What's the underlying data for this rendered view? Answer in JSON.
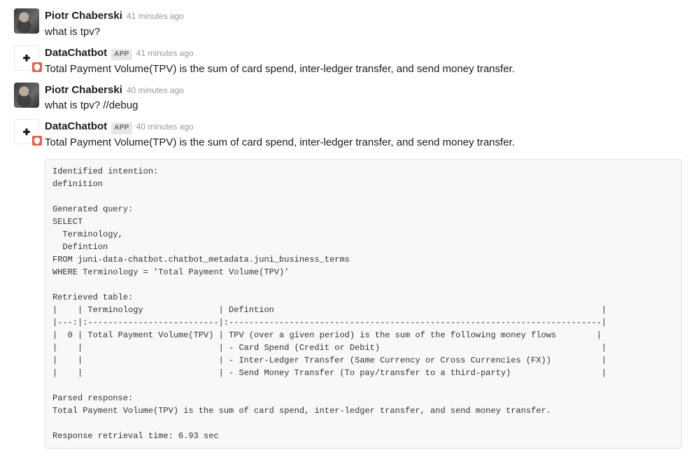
{
  "messages": [
    {
      "author": "Piotr Chaberski",
      "is_app": false,
      "timestamp": "41 minutes ago",
      "text": "what is tpv?",
      "avatar_kind": "user",
      "has_overlay": false
    },
    {
      "author": "DataChatbot",
      "is_app": true,
      "app_label": "APP",
      "timestamp": "41 minutes ago",
      "text": "Total Payment Volume(TPV) is the sum of card spend, inter-ledger transfer, and send money transfer.",
      "avatar_kind": "bot",
      "has_overlay": true
    },
    {
      "author": "Piotr Chaberski",
      "is_app": false,
      "timestamp": "40 minutes ago",
      "text": "what is tpv? //debug",
      "avatar_kind": "user",
      "has_overlay": false
    },
    {
      "author": "DataChatbot",
      "is_app": true,
      "app_label": "APP",
      "timestamp": "40 minutes ago",
      "text": "Total Payment Volume(TPV) is the sum of card spend, inter-ledger transfer, and send money transfer.",
      "avatar_kind": "bot",
      "has_overlay": true
    }
  ],
  "code_block": "Identified intention:\ndefinition\n\nGenerated query:\nSELECT\n  Terminology,\n  Defintion\nFROM juni-data-chatbot.chatbot_metadata.juni_business_terms\nWHERE Terminology = 'Total Payment Volume(TPV)'\n\nRetrieved table:\n|    | Terminology               | Defintion                                                                 |\n|---:|:--------------------------|:--------------------------------------------------------------------------|\n|  0 | Total Payment Volume(TPV) | TPV (over a given period) is the sum of the following money flows        |\n|    |                           | - Card Spend (Credit or Debit)                                            |\n|    |                           | - Inter-Ledger Transfer (Same Currency or Cross Currencies (FX))          |\n|    |                           | - Send Money Transfer (To pay/transfer to a third-party)                  |\n\nParsed response:\nTotal Payment Volume(TPV) is the sum of card spend, inter-ledger transfer, and send money transfer.\n\nResponse retrieval time: 6.93 sec"
}
